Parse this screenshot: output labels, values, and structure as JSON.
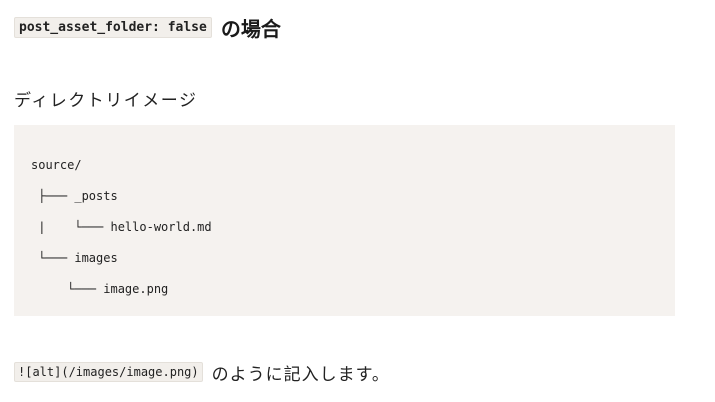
{
  "heading": {
    "code": "post_asset_folder: false",
    "text": "の場合"
  },
  "subtitle": "ディレクトリイメージ",
  "directory_tree": [
    "source/",
    " ├─── _posts",
    " |    └─── hello-world.md",
    " └─── images",
    "     └─── image.png"
  ],
  "usage": {
    "code": "![alt](/images/image.png)",
    "text": "のように記入します。"
  }
}
